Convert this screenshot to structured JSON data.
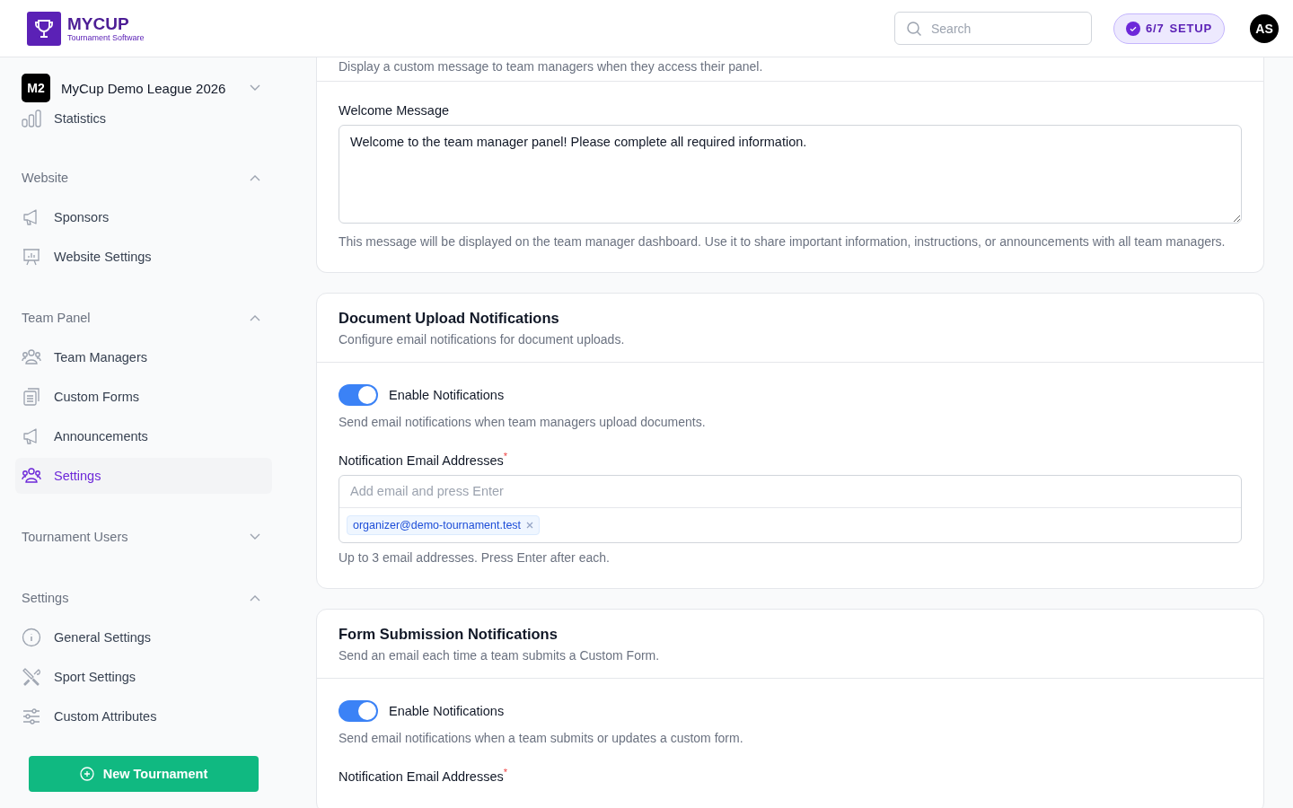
{
  "header": {
    "logo_title": "MYCUP",
    "logo_subtitle": "Tournament Software",
    "search": {
      "placeholder": "Search"
    },
    "setup": {
      "count": "6/7",
      "label": "SETUP"
    },
    "avatar": "AS"
  },
  "sidebar": {
    "league": {
      "badge": "M2",
      "name": "MyCup Demo League 2026"
    },
    "top_items": [
      {
        "label": "Statistics",
        "selected": false
      }
    ],
    "sections": [
      {
        "title": "Website",
        "expanded": true,
        "items": [
          {
            "label": "Sponsors",
            "selected": false
          },
          {
            "label": "Website Settings",
            "selected": false
          }
        ]
      },
      {
        "title": "Team Panel",
        "expanded": true,
        "items": [
          {
            "label": "Team Managers",
            "selected": false
          },
          {
            "label": "Custom Forms",
            "selected": false
          },
          {
            "label": "Announcements",
            "selected": false
          },
          {
            "label": "Settings",
            "selected": true
          }
        ]
      },
      {
        "title": "Tournament Users",
        "expanded": false
      },
      {
        "title": "Settings",
        "expanded": true,
        "items": [
          {
            "label": "General Settings",
            "selected": false
          },
          {
            "label": "Sport Settings",
            "selected": false
          },
          {
            "label": "Custom Attributes",
            "selected": false
          }
        ]
      }
    ],
    "new_button": "New Tournament"
  },
  "cards": [
    {
      "subtitle": "Display a custom message to team managers when they access their panel.",
      "fields": [
        {
          "kind": "textarea",
          "label": "Welcome Message",
          "value": "Welcome to the team manager panel! Please complete all required information.",
          "help": "This message will be displayed on the team manager dashboard. Use it to share important information, instructions, or announcements with all team managers."
        }
      ]
    },
    {
      "title": "Document Upload Notifications",
      "subtitle": "Configure email notifications for document uploads.",
      "fields": [
        {
          "kind": "toggle",
          "label": "Enable Notifications",
          "on": true,
          "help": "Send email notifications when team managers upload documents."
        },
        {
          "kind": "emails",
          "label": "Notification Email Addresses",
          "required_mark": "*",
          "placeholder": "Add email and press Enter",
          "tags": [
            "organizer@demo-tournament.test"
          ],
          "help": "Up to 3 email addresses. Press Enter after each."
        }
      ]
    },
    {
      "title": "Form Submission Notifications",
      "subtitle": "Send an email each time a team submits a Custom Form.",
      "fields": [
        {
          "kind": "toggle",
          "label": "Enable Notifications",
          "on": true,
          "help": "Send email notifications when a team submits or updates a custom form."
        },
        {
          "kind": "label",
          "label": "Notification Email Addresses",
          "required_mark": "*"
        }
      ]
    }
  ]
}
